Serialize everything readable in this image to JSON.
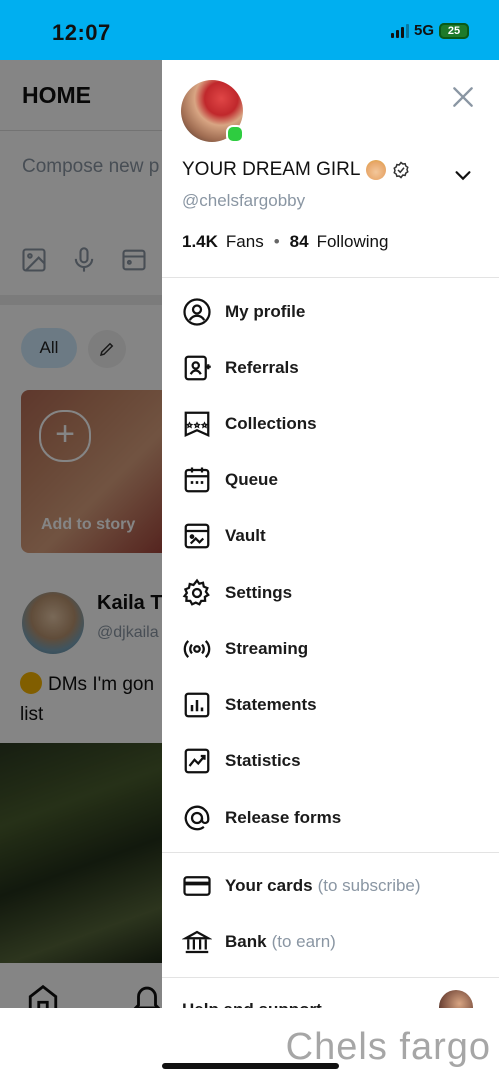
{
  "status_bar": {
    "time": "12:07",
    "network": "5G",
    "battery": "25",
    "background_color": "#00aff0"
  },
  "background_app": {
    "home_title": "HOME",
    "compose_placeholder": "Compose new p",
    "filter_all": "All",
    "add_to_story": "Add to story",
    "post_author": "Kaila T",
    "post_handle": "@djkaila",
    "post_text": "DMs I'm gon list"
  },
  "drawer": {
    "display_name": "YOUR DREAM GIRL",
    "username": "@chelsfargobby",
    "fans_count": "1.4K",
    "fans_label": "Fans",
    "separator": "•",
    "following_count": "84",
    "following_label": "Following",
    "menu": [
      {
        "label": "My profile",
        "icon": "user-circle-icon"
      },
      {
        "label": "Referrals",
        "icon": "referral-icon"
      },
      {
        "label": "Collections",
        "icon": "collections-icon"
      },
      {
        "label": "Queue",
        "icon": "calendar-icon"
      },
      {
        "label": "Vault",
        "icon": "vault-icon"
      },
      {
        "label": "Settings",
        "icon": "gear-icon"
      },
      {
        "label": "Streaming",
        "icon": "broadcast-icon"
      },
      {
        "label": "Statements",
        "icon": "statements-icon"
      },
      {
        "label": "Statistics",
        "icon": "statistics-icon"
      },
      {
        "label": "Release forms",
        "icon": "at-icon"
      }
    ],
    "payment": [
      {
        "label": "Your cards",
        "sub": "(to subscribe)",
        "icon": "card-icon"
      },
      {
        "label": "Bank",
        "sub": "(to earn)",
        "icon": "bank-icon"
      }
    ],
    "partial_item": "Help and support"
  },
  "watermark": "Chels fargo",
  "colors": {
    "accent": "#00aff0",
    "muted": "#8a96a3",
    "online": "#2ecc40"
  }
}
